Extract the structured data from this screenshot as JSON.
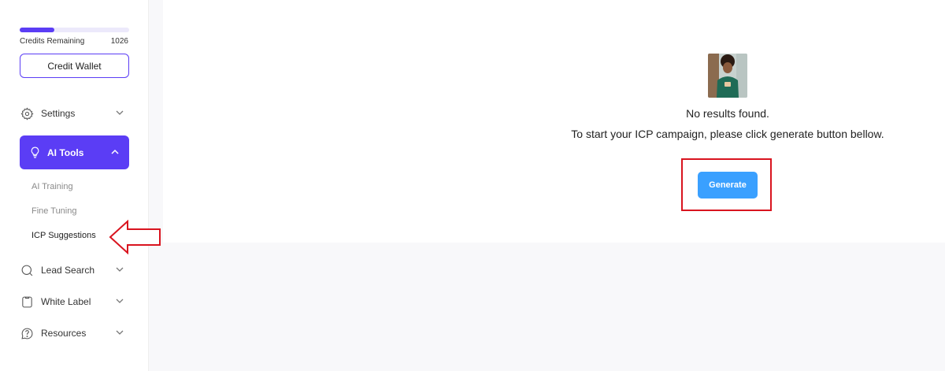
{
  "sidebar": {
    "credits": {
      "label": "Credits Remaining",
      "value": "1026",
      "fill_fraction": 0.32
    },
    "credit_wallet_label": "Credit Wallet",
    "items": [
      {
        "label": "Settings",
        "icon": "gear-icon",
        "chevron": "chevron-down-icon"
      },
      {
        "label": "AI Tools",
        "icon": "lightbulb-icon",
        "chevron": "chevron-up-icon",
        "active": true
      },
      {
        "label": "Lead Search",
        "icon": "search-icon",
        "chevron": "chevron-down-icon"
      },
      {
        "label": "White Label",
        "icon": "tag-icon",
        "chevron": "chevron-down-icon"
      },
      {
        "label": "Resources",
        "icon": "help-icon",
        "chevron": "chevron-down-icon"
      }
    ],
    "ai_tools_subitems": [
      {
        "label": "AI Training"
      },
      {
        "label": "Fine Tuning"
      },
      {
        "label": "ICP Suggestions",
        "current": true
      }
    ]
  },
  "main": {
    "empty_state": {
      "title": "No results found.",
      "description": "To start your ICP campaign, please click generate button bellow.",
      "generate_label": "Generate"
    }
  },
  "colors": {
    "accent": "#5b3df5",
    "generate_button": "#3aa0ff",
    "annotation": "#d9141f"
  }
}
